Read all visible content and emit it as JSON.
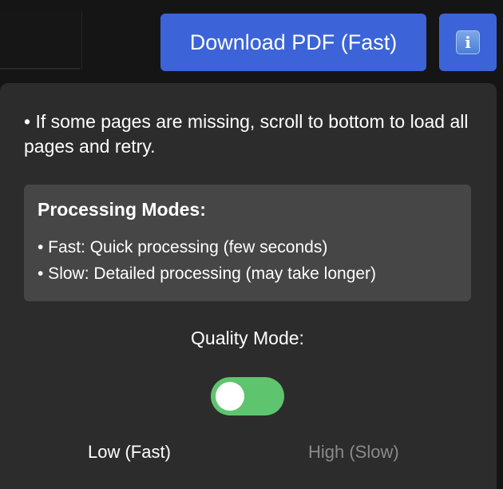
{
  "header": {
    "download_button_label": "Download PDF (Fast)",
    "info_icon_glyph": "i"
  },
  "panel": {
    "note_text": "• If some pages are missing, scroll to bottom to load all pages and retry.",
    "modes": {
      "title": "Processing Modes:",
      "items": [
        "• Fast: Quick processing (few seconds)",
        "• Slow: Detailed processing (may take longer)"
      ]
    },
    "quality": {
      "label": "Quality Mode:",
      "toggle_on": true,
      "low_option": "Low (Fast)",
      "high_option": "High (Slow)",
      "selected": "Low (Fast)"
    }
  },
  "colors": {
    "button_blue": "#3c64d8",
    "toggle_green": "#5fc46e",
    "panel_bg": "#2c2c2c",
    "box_bg": "#464646",
    "inactive_text": "#8a8a8a"
  },
  "icons": {
    "info": "info-icon"
  }
}
